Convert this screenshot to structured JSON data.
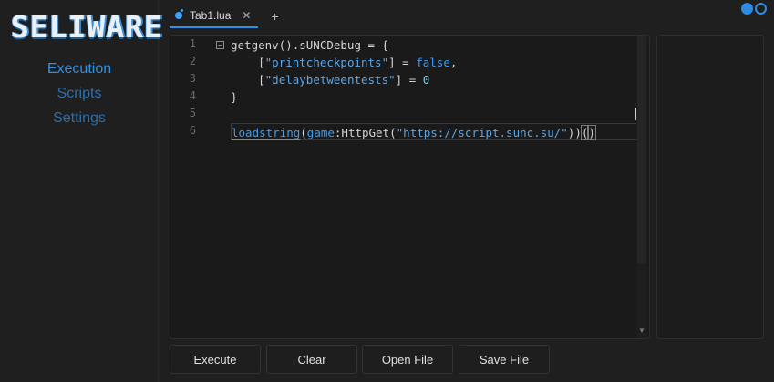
{
  "app": {
    "logo_text": "SELIWARE"
  },
  "sidebar": {
    "items": [
      {
        "label": "Execution",
        "active": true
      },
      {
        "label": "Scripts",
        "active": false
      },
      {
        "label": "Settings",
        "active": false
      }
    ]
  },
  "status": {
    "dots": [
      "filled",
      "outline"
    ]
  },
  "tabs": [
    {
      "label": "Tab1.lua",
      "close": "✕"
    }
  ],
  "tab_add": "+",
  "editor": {
    "line_numbers": [
      "1",
      "2",
      "3",
      "4",
      "5",
      "6"
    ],
    "fold_marker": "−",
    "lines": [
      "getgenv().sUNCDebug = {",
      "    [\"printcheckpoints\"] = false,",
      "    [\"delaybetweentests\"] = 0",
      "}",
      "",
      "loadstring(game:HttpGet(\"https://script.sunc.su/\"))()"
    ]
  },
  "buttons": {
    "execute": "Execute",
    "clear": "Clear",
    "open_file": "Open File",
    "save_file": "Save File"
  },
  "colors": {
    "accent": "#2f8fe5",
    "string": "#5aa6e8",
    "keyword": "#3d9cf0",
    "number": "#5fd7ff"
  }
}
